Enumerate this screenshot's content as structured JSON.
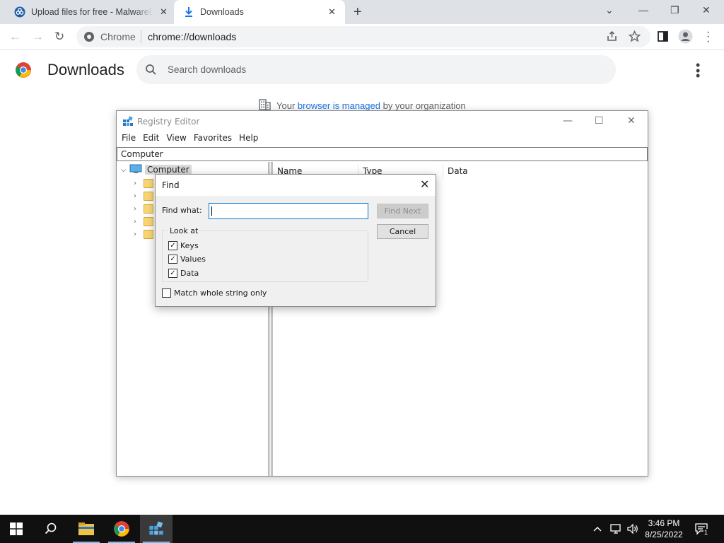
{
  "tabs": [
    {
      "title": "Upload files for free - MalwareDatabase"
    },
    {
      "title": "Downloads"
    }
  ],
  "omnibox": {
    "site_chip": "Chrome",
    "url": "chrome://downloads"
  },
  "downloads": {
    "title": "Downloads",
    "search_placeholder": "Search downloads",
    "managed_prefix": "Your",
    "managed_link": "browser is managed",
    "managed_suffix": "by your organization"
  },
  "regedit": {
    "title": "Registry Editor",
    "menu": [
      "File",
      "Edit",
      "View",
      "Favorites",
      "Help"
    ],
    "address": "Computer",
    "tree_root": "Computer",
    "columns": [
      "Name",
      "Type",
      "Data"
    ]
  },
  "find_dialog": {
    "title": "Find",
    "find_what_label": "Find what:",
    "find_what_value": "",
    "find_next": "Find Next",
    "cancel": "Cancel",
    "look_at": "Look at",
    "options": [
      {
        "label": "Keys",
        "checked": true
      },
      {
        "label": "Values",
        "checked": true
      },
      {
        "label": "Data",
        "checked": true
      }
    ],
    "match_whole": {
      "label": "Match whole string only",
      "checked": false
    }
  },
  "taskbar": {
    "time": "3:46 PM",
    "date": "8/25/2022",
    "notification_count": "1"
  },
  "colors": {
    "chrome_tabstrip": "#dee1e6",
    "link": "#1a73e8",
    "taskbar": "#101010",
    "focus": "#0078d7"
  }
}
